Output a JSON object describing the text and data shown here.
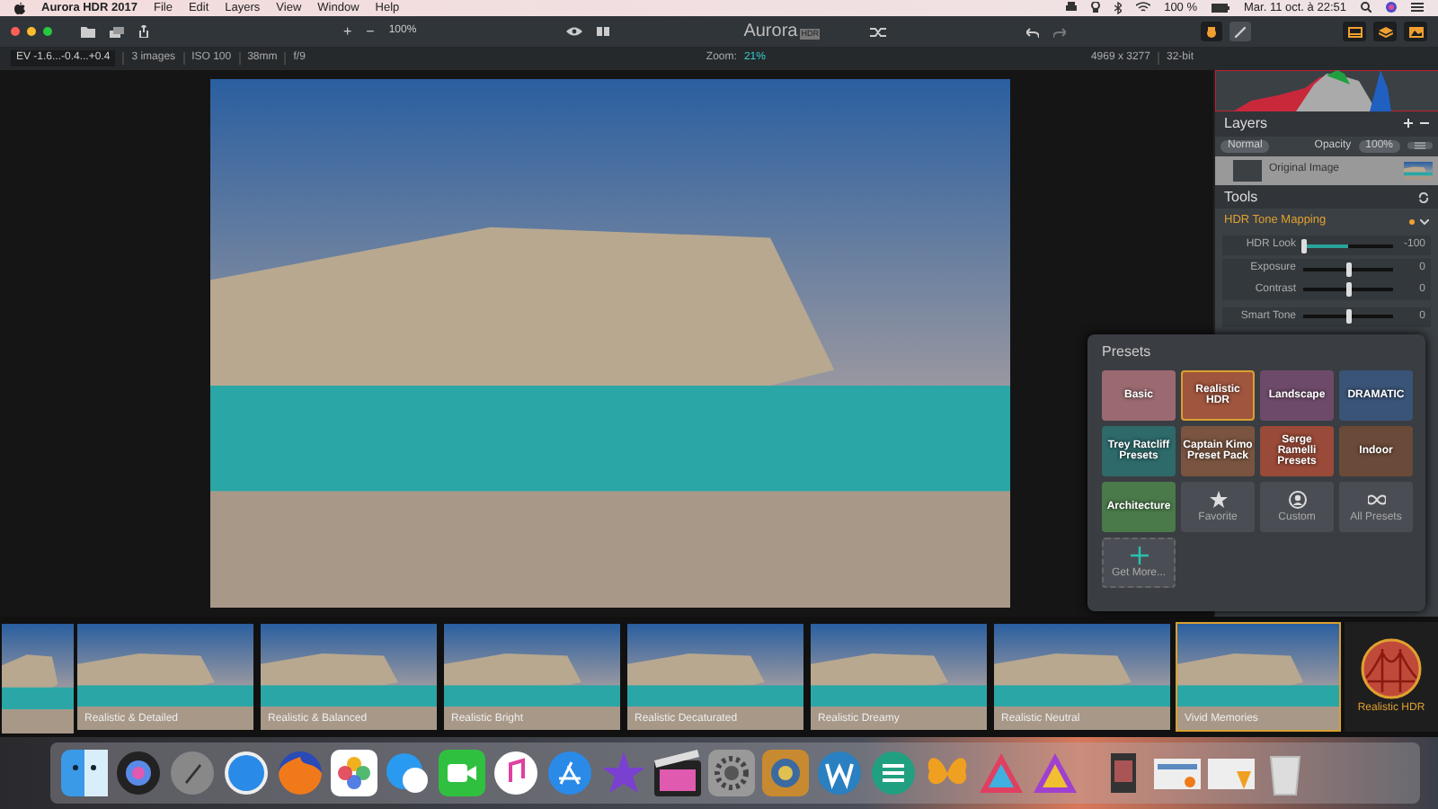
{
  "menu_bar": {
    "app_name": "Aurora HDR 2017",
    "menus": [
      "File",
      "Edit",
      "Layers",
      "View",
      "Window",
      "Help"
    ],
    "battery": "100 %",
    "clock": "Mar. 11 oct. à 22:51"
  },
  "toolbar": {
    "zoom_in": "+",
    "zoom_out": "−",
    "zoom": "100%",
    "logo": "Aurora",
    "logo_badge": "HDR",
    "mode_buttons": [
      {
        "kind": "hand",
        "selected": true
      },
      {
        "kind": "brush",
        "selected": false
      }
    ]
  },
  "info_bar": {
    "ev": "EV -1.6...-0.4...+0.4",
    "items": [
      "3 images",
      "ISO 100",
      "38mm",
      "f/9"
    ],
    "zoom_label": "Zoom:",
    "zoom_value": "21%",
    "dimensions": "4969 x 3277",
    "bit_depth": "32-bit"
  },
  "layers": {
    "title": "Layers",
    "blend_mode": "Normal",
    "opacity_label": "Opacity",
    "opacity": "100%",
    "layer_name": "Original Image"
  },
  "tools": {
    "title": "Tools",
    "section": "HDR Tone Mapping",
    "sliders": [
      {
        "label": "HDR Look",
        "value": "-100",
        "level": 0
      },
      {
        "label": "Exposure",
        "value": "0",
        "level": 0.5
      },
      {
        "label": "Contrast",
        "value": "0",
        "level": 0.5
      },
      {
        "label": "Smart Tone",
        "value": "0",
        "level": 0.5
      }
    ]
  },
  "presets": {
    "title": "Presets",
    "items": [
      {
        "kind": "image",
        "label": "Basic",
        "color": "#9a6a70",
        "selected": false
      },
      {
        "kind": "image",
        "label": "Realistic HDR",
        "color": "#a0553e",
        "selected": true
      },
      {
        "kind": "image",
        "label": "Landscape",
        "color": "#6e4a6a",
        "selected": false
      },
      {
        "kind": "image",
        "label": "DRAMATIC",
        "color": "#3a5478",
        "selected": false
      },
      {
        "kind": "image",
        "label": "Trey Ratcliff Presets",
        "color": "#2e6a6a",
        "selected": false
      },
      {
        "kind": "image",
        "label": "Captain Kimo Preset Pack",
        "color": "#7a5440",
        "selected": false
      },
      {
        "kind": "image",
        "label": "Serge Ramelli Presets",
        "color": "#9a4a38",
        "selected": false
      },
      {
        "kind": "image",
        "label": "Indoor",
        "color": "#6a4a38",
        "selected": false
      },
      {
        "kind": "image",
        "label": "Architecture",
        "color": "#4a7a4a",
        "selected": false
      },
      {
        "kind": "star",
        "label": "Favorite",
        "selected": false
      },
      {
        "kind": "person",
        "label": "Custom",
        "selected": false
      },
      {
        "kind": "infinity",
        "label": "All Presets",
        "selected": false
      }
    ],
    "get_more": "Get More..."
  },
  "filmstrip": {
    "items": [
      {
        "label": "Realistic & Detailed",
        "selected": false
      },
      {
        "label": "Realistic & Balanced",
        "selected": false
      },
      {
        "label": "Realistic Bright",
        "selected": false
      },
      {
        "label": "Realistic Decaturated",
        "selected": false
      },
      {
        "label": "Realistic Dreamy",
        "selected": false
      },
      {
        "label": "Realistic Neutral",
        "selected": false
      },
      {
        "label": "Vivid Memories",
        "selected": true
      }
    ],
    "current": "Realistic HDR"
  }
}
